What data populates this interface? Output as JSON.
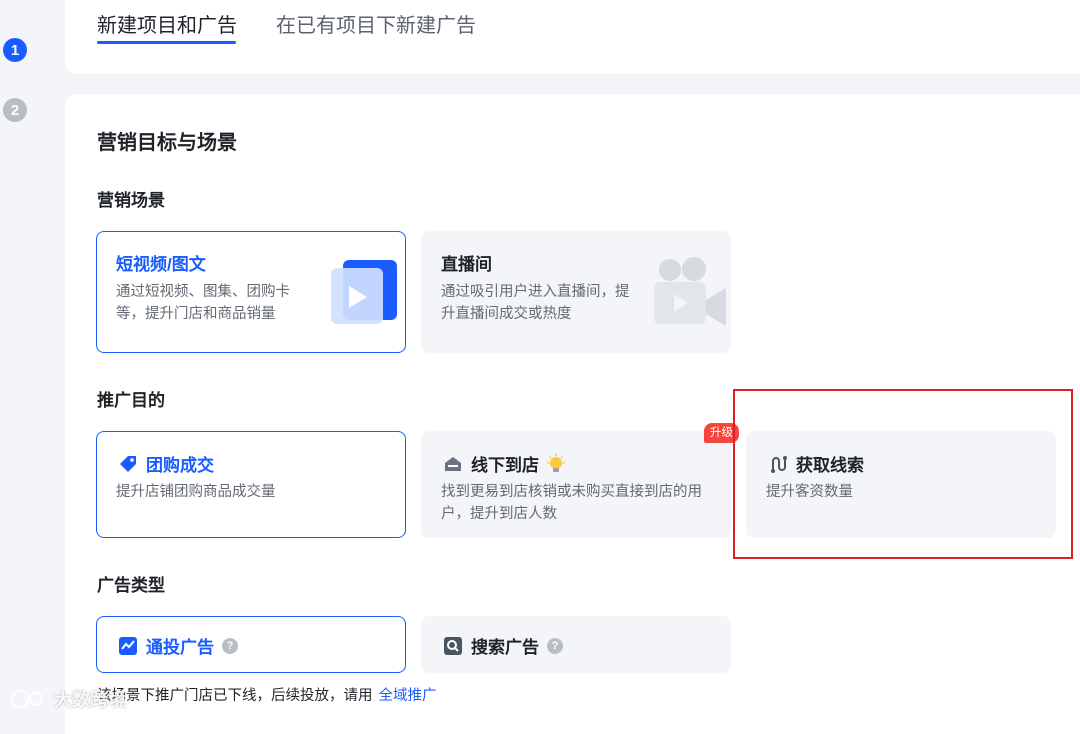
{
  "steps": [
    "1",
    "2"
  ],
  "tabs": [
    {
      "label": "新建项目和广告",
      "active": true
    },
    {
      "label": "在已有项目下新建广告",
      "active": false
    }
  ],
  "section_title": "营销目标与场景",
  "scene": {
    "label": "营销场景",
    "options": [
      {
        "title": "短视频/图文",
        "desc": [
          "通过短视频、图集、团购卡",
          "等，提升门店和商品销量"
        ],
        "selected": true,
        "icon": "video-card-icon"
      },
      {
        "title": "直播间",
        "desc": [
          "通过吸引用户进入直播间，提",
          "升直播间成交或热度"
        ],
        "selected": false,
        "icon": "camera-icon"
      }
    ]
  },
  "goal": {
    "label": "推广目的",
    "options": [
      {
        "title": "团购成交",
        "desc": [
          "提升店铺团购商品成交量"
        ],
        "selected": true,
        "icon": "tag-icon"
      },
      {
        "title": "线下到店",
        "desc": [
          "找到更易到店核销或未购买直接到店的用",
          "户，提升到店人数"
        ],
        "selected": false,
        "icon": "store-icon",
        "badge": "升级"
      },
      {
        "title": "获取线索",
        "desc": [
          "提升客资数量"
        ],
        "selected": false,
        "icon": "route-icon"
      }
    ]
  },
  "adtype": {
    "label": "广告类型",
    "options": [
      {
        "title": "通投广告",
        "selected": true,
        "icon": "chart-icon"
      },
      {
        "title": "搜索广告",
        "selected": false,
        "icon": "search-icon"
      }
    ]
  },
  "notice": {
    "text": "该场景下推广门店已下线，后续投放，请用",
    "link": "全域推广"
  },
  "watermark": "大数跨境",
  "colors": {
    "accent": "#1a5cff",
    "badge": "#f5453d",
    "highlight_box": "#e02020"
  }
}
